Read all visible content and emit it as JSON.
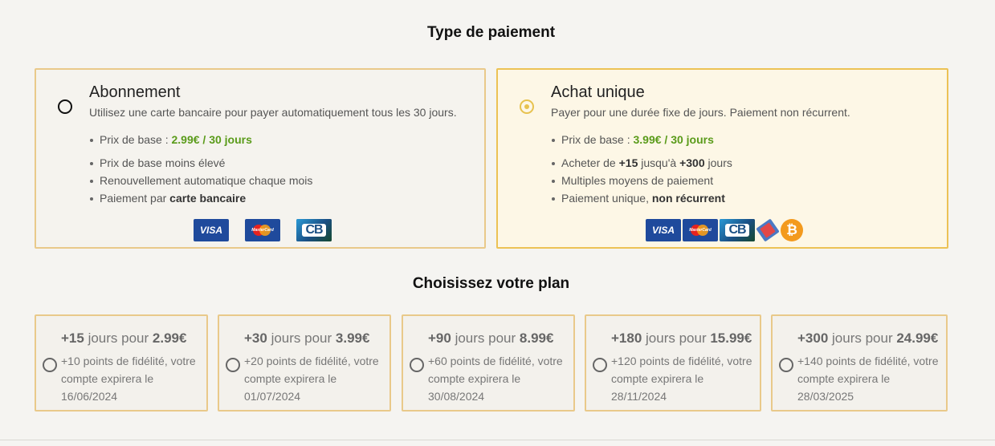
{
  "payment_title": "Type de paiement",
  "plan_title": "Choisissez votre plan",
  "subscription": {
    "title": "Abonnement",
    "description": "Utilisez une carte bancaire pour payer automatiquement tous les 30 jours.",
    "base_price_label": "Prix de base : ",
    "base_price_value": "2.99€ / 30 jours",
    "feature_1": "Prix de base moins élevé",
    "feature_2": "Renouvellement automatique chaque mois",
    "feature_3_prefix": "Paiement par ",
    "feature_3_bold": "carte bancaire",
    "selected": false,
    "logos": [
      "VISA",
      "MasterCard",
      "CB"
    ]
  },
  "one_time": {
    "title": "Achat unique",
    "description": "Payer pour une durée fixe de jours. Paiement non récurrent.",
    "base_price_label": "Prix de base : ",
    "base_price_value": "3.99€ / 30 jours",
    "feature_1_prefix": "Acheter de ",
    "feature_1_b1": "+15",
    "feature_1_mid": " jusqu'à ",
    "feature_1_b2": "+300",
    "feature_1_suffix": " jours",
    "feature_2": "Multiples moyens de paiement",
    "feature_3_prefix": "Paiement unique, ",
    "feature_3_bold": "non récurrent",
    "selected": true,
    "logos": [
      "VISA",
      "MasterCard",
      "CB",
      "ticket-icon",
      "bitcoin-icon"
    ]
  },
  "plans": [
    {
      "days": "+15",
      "mid": " jours pour ",
      "price": "2.99€",
      "line1": "+10 points de fidélité, votre",
      "line2": "compte expirera le",
      "line3": "16/06/2024"
    },
    {
      "days": "+30",
      "mid": " jours pour ",
      "price": "3.99€",
      "line1": "+20 points de fidélité, votre",
      "line2": "compte expirera le",
      "line3": "01/07/2024"
    },
    {
      "days": "+90",
      "mid": " jours pour ",
      "price": "8.99€",
      "line1": "+60 points de fidélité, votre",
      "line2": "compte expirera le",
      "line3": "30/08/2024"
    },
    {
      "days": "+180",
      "mid": " jours pour ",
      "price": "15.99€",
      "line1": "+120 points de fidélité, votre",
      "line2": "compte expirera le",
      "line3": "28/11/2024"
    },
    {
      "days": "+300",
      "mid": " jours pour ",
      "price": "24.99€",
      "line1": "+140 points de fidélité, votre",
      "line2": "compte expirera le",
      "line3": "28/03/2025"
    }
  ],
  "colors": {
    "accent": "#ecc255",
    "price_green": "#5a9b1a",
    "card_border": "#e9c98a"
  }
}
